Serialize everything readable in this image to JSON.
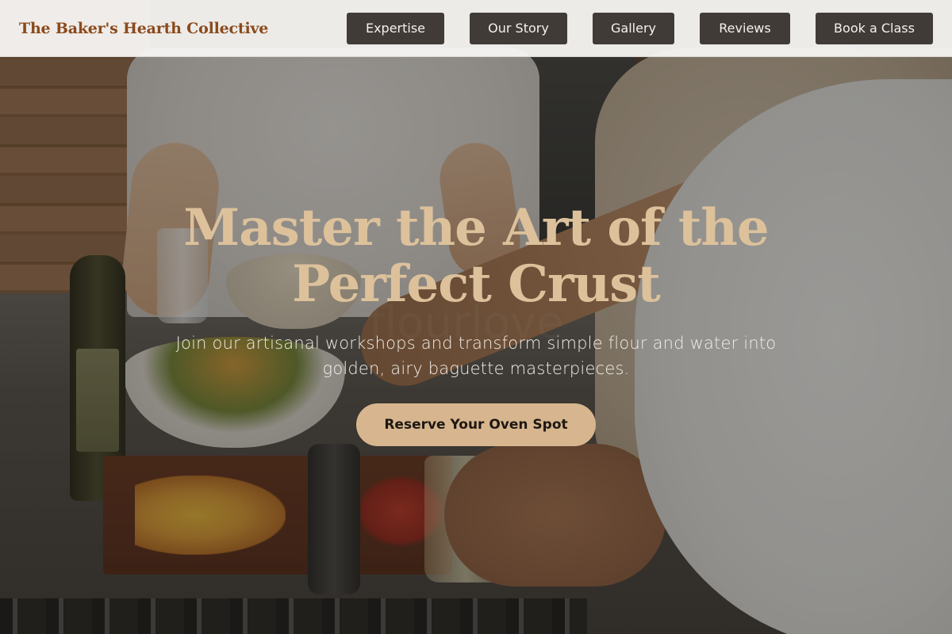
{
  "header": {
    "brand": "The Baker's Hearth Collective",
    "nav": [
      {
        "label": "Expertise"
      },
      {
        "label": "Our Story"
      },
      {
        "label": "Gallery"
      },
      {
        "label": "Reviews"
      },
      {
        "label": "Book a Class"
      }
    ]
  },
  "hero": {
    "title_line1": "Master the Art of the",
    "title_line2": "Perfect Crust",
    "subtitle_line1": "Join our artisanal workshops and transform simple flour and water into",
    "subtitle_line2": "golden, airy baguette masterpieces.",
    "cta_label": "Reserve Your Oven Spot",
    "background_watermark": "flourlove"
  },
  "colors": {
    "brand": "#8b4a1c",
    "nav_background": "#413b37",
    "title": "#dcc19b",
    "cta_background": "#d7b58e",
    "header_background": "#f8f6f4"
  }
}
